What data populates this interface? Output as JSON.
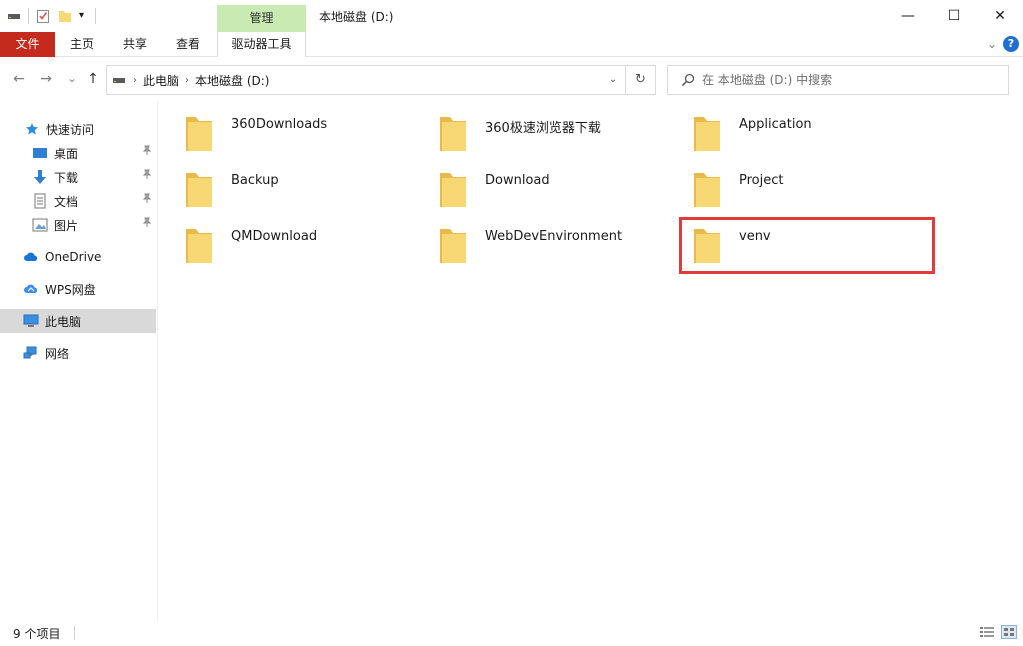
{
  "window": {
    "title": "本地磁盘 (D:)",
    "context_tab_group": "管理",
    "controls": {
      "minimize": "—",
      "maximize": "☐",
      "close": "✕"
    }
  },
  "qat": {
    "dropdown_glyph": "▾"
  },
  "ribbon": {
    "tabs": [
      "文件",
      "主页",
      "共享",
      "查看",
      "驱动器工具"
    ],
    "collapse_glyph": "⌄",
    "help_glyph": "?"
  },
  "address": {
    "back": "←",
    "forward": "→",
    "recent": "⌄",
    "up": "↑",
    "breadcrumb": [
      "此电脑",
      "本地磁盘 (D:)"
    ],
    "separator": "›",
    "dropdown": "⌄",
    "refresh": "↻"
  },
  "search": {
    "placeholder": "在 本地磁盘 (D:) 中搜索"
  },
  "nav_pane": {
    "items": [
      {
        "label": "快速访问",
        "icon": "star-icon",
        "pinned": false
      },
      {
        "label": "桌面",
        "icon": "desktop-icon",
        "pinned": true
      },
      {
        "label": "下载",
        "icon": "download-arrow-icon",
        "pinned": true
      },
      {
        "label": "文档",
        "icon": "document-icon",
        "pinned": true
      },
      {
        "label": "图片",
        "icon": "picture-icon",
        "pinned": true
      },
      {
        "label": "OneDrive",
        "icon": "cloud-icon",
        "pinned": false
      },
      {
        "label": "WPS网盘",
        "icon": "wps-cloud-icon",
        "pinned": false
      },
      {
        "label": "此电脑",
        "icon": "computer-icon",
        "pinned": false
      },
      {
        "label": "网络",
        "icon": "network-icon",
        "pinned": false
      }
    ],
    "pin_glyph": "📌",
    "selected": "此电脑"
  },
  "folders": [
    "360Downloads",
    "360极速浏览器下载",
    "Application",
    "Backup",
    "Download",
    "Project",
    "QMDownload",
    "WebDevEnvironment",
    "venv"
  ],
  "highlighted_folder": "venv",
  "status": {
    "item_count": "9 个项目"
  },
  "colors": {
    "file_tab": "#c42b1c",
    "manage_tab": "#c9eab3",
    "selection": "#d9d9d9",
    "highlight_box": "#e03c3c",
    "folder_yellow": "#f8d775",
    "help_blue": "#1e6fd1"
  }
}
